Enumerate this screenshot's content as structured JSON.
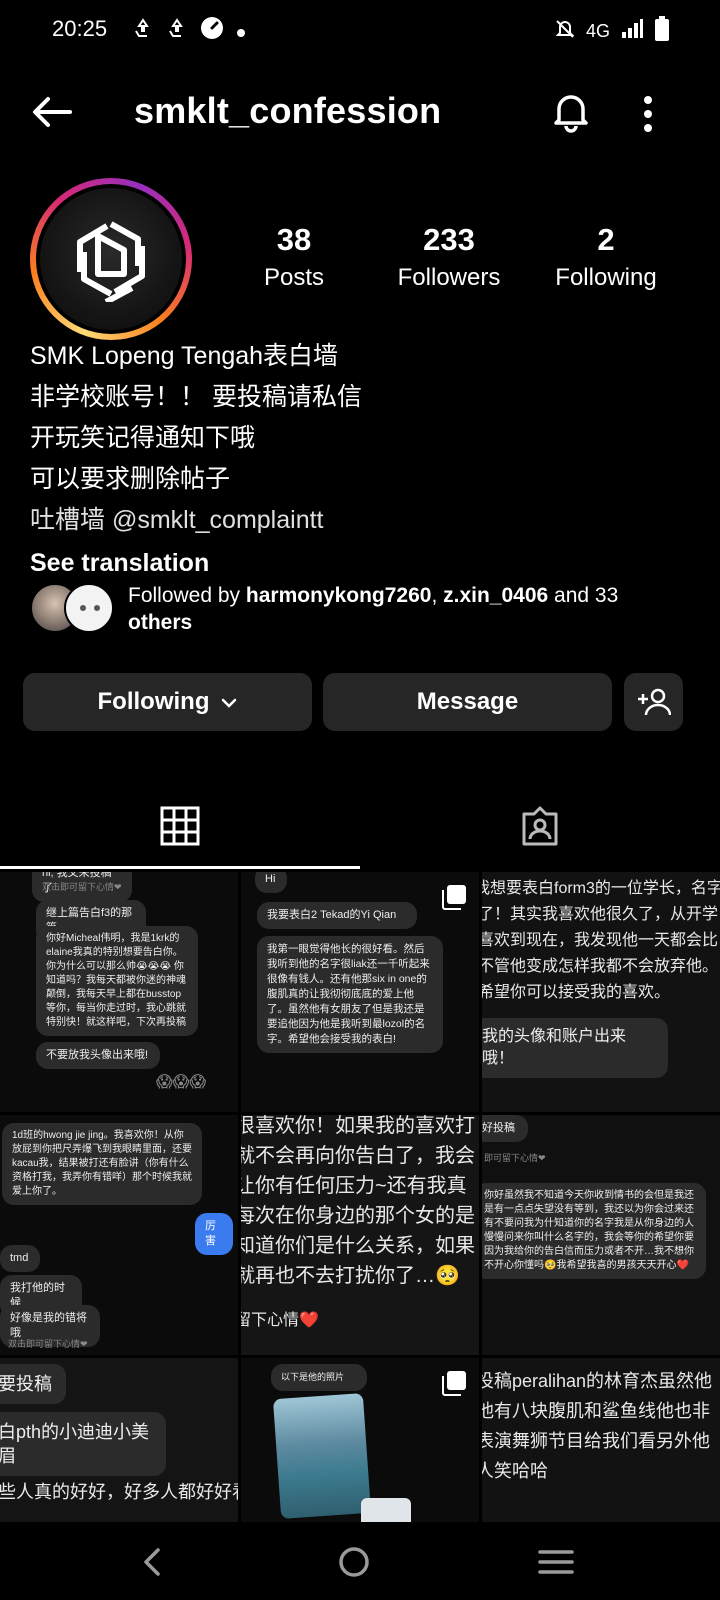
{
  "status_bar": {
    "time": "20:25",
    "left_icons": [
      "recycle-icon",
      "recycle-icon",
      "speedometer-icon",
      "dot-icon"
    ],
    "network": "4G",
    "right_icons": [
      "mute-icon",
      "signal-icon",
      "battery-icon"
    ]
  },
  "header": {
    "username": "smklt_confession",
    "icons": [
      "back-arrow-icon",
      "bell-icon",
      "more-vertical-icon"
    ]
  },
  "profile": {
    "stats": [
      {
        "value": "38",
        "label": "Posts"
      },
      {
        "value": "233",
        "label": "Followers"
      },
      {
        "value": "2",
        "label": "Following"
      }
    ],
    "bio_lines": [
      "SMK Lopeng Tengah表白墙",
      "非学校账号！！ 要投稿请私信",
      "开玩笑记得通知下哦",
      "可以要求删除帖子",
      "吐槽墙 @smklt_complaintt"
    ],
    "see_translation": "See translation",
    "followed_by": {
      "prefix": "Followed by ",
      "user1": "harmonykong7260",
      "separator": ", ",
      "user2": "z.xin_0406",
      "and": " and 33",
      "others": "others"
    }
  },
  "actions": {
    "following": "Following",
    "message": "Message"
  },
  "tabs": [
    {
      "name": "grid",
      "icon": "grid-icon",
      "active": true
    },
    {
      "name": "tagged",
      "icon": "tagged-person-icon",
      "active": false
    }
  ],
  "posts": {
    "p1": {
      "b1": "hi, 我又来投稿了",
      "note1": "双击即可留下心情❤",
      "b2": "继上篇告白f3的那篇",
      "b3": "你好Micheal伟明，我是1krk的elaine我真的特别想要告白你。你为什么可以那么帅😭😭😭 你知道吗？我每天都被你迷的神魂颠倒，我每天早上都在busstop等你，每当你走过时，我心跳就特别快！就这样吧，下次再投稿",
      "b4": "不要放我头像出来哦!",
      "emoji": "😱😱😱"
    },
    "p2": {
      "b1": "Hi",
      "b2": "我要表白2 Tekad的Yi Qian",
      "b3": "我第一眼觉得他长的很好看。然后我听到他的名字很liak还一千听起来很像有钱人。还有他那six in one的腹肌真的让我彻彻底底的爱上他了。虽然他有女朋友了但是我还是要追他因为他是我听到最lozol的名字。希望他会接受我的表白!"
    },
    "p3": {
      "l1": "我想要表白form3的一位学长，名字",
      "l2": "了！其实我喜欢他很久了，从开学",
      "l3": "喜欢到现在，我发现他一天都会比",
      "l4": "不管他变成怎样我都不会放弃他。",
      "l5": "希望你可以接受我的喜欢。",
      "l6": "我的头像和账户出来哦！"
    },
    "p4": {
      "b1": "1d班的hwong jie jing。我喜欢你！从你放屁到你把尺弄爆飞到我眼睛里面，还要kacau我，结果被打还有脸讲（你有什么资格打我，我弄你有错咩）那个时候我就爱上你了。",
      "blue": "厉害",
      "b2": "tmd",
      "b3": "我打他的时候",
      "b4": "好像是我的错将哦",
      "note": "双击即可留下心情❤"
    },
    "p5": {
      "l1": "很喜欢你！如果我的喜欢打",
      "l2": "就不会再向你告白了，我会",
      "l3": "让你有任何压力~还有我真",
      "l4": "每次在你身边的那个女的是",
      "l5": "知道你们是什么关系，如果",
      "l6": "就再也不去打扰你了…🥺",
      "l7": "留下心情❤️"
    },
    "p6": {
      "b1": "好投稿",
      "note": "即可留下心情❤",
      "b2": "你好虽然我不知道今天你收到情书的会但是我还是有一点点失望没有等到，我还以为你会过来还有不要问我为什知道你的名字我是从你身边的人慢慢问来你叫什么名字的，我会等你的希望你要因为我给你的告白信而压力或者不开…我不想你不开心你懂吗🥺我希望我喜的男孩天天开心❤️"
    },
    "p7": {
      "l1": "要投稿",
      "l2": "白pth的小迪迪小美眉",
      "l3": "些人真的好好，好多人都好好看，"
    },
    "p8": {
      "b1": "以下是他的照片"
    },
    "p9": {
      "l1": "投稿peralihan的林育杰虽然他",
      "l2": "他有八块腹肌和鲨鱼线他也非",
      "l3": "表演舞狮节目给我们看另外他",
      "l4": "人笑哈哈"
    }
  },
  "nav_bar": [
    "back-nav-icon",
    "home-nav-icon",
    "recent-apps-icon"
  ]
}
